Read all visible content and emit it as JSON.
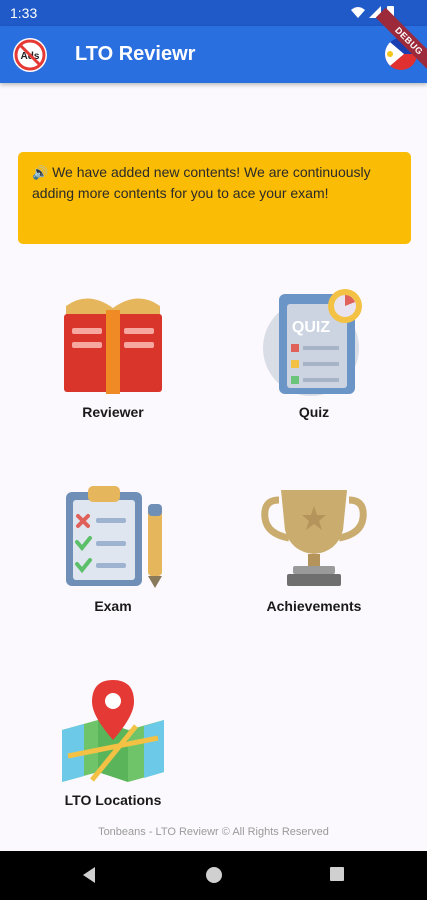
{
  "status_bar": {
    "time": "1:33",
    "debug_label": "DEBUG"
  },
  "app_bar": {
    "title": "LTO Reviewr",
    "ads_label": "Ads"
  },
  "notice": {
    "icon": "speaker-icon",
    "text": "We have added new contents! We are continuously adding more contents for you to ace your exam!"
  },
  "menu": {
    "reviewer": {
      "label": "Reviewer"
    },
    "quiz": {
      "label": "Quiz",
      "icon_text": "QUIZ"
    },
    "exam": {
      "label": "Exam"
    },
    "achievements": {
      "label": "Achievements"
    },
    "locations": {
      "label": "LTO Locations"
    }
  },
  "footer": {
    "text": "Tonbeans - LTO Reviewr © All Rights Reserved"
  },
  "colors": {
    "status_bar": "#1f5ac8",
    "app_bar": "#2a6fe0",
    "notice_bg": "#fbbc05",
    "page_bg": "#fbf9fd"
  }
}
